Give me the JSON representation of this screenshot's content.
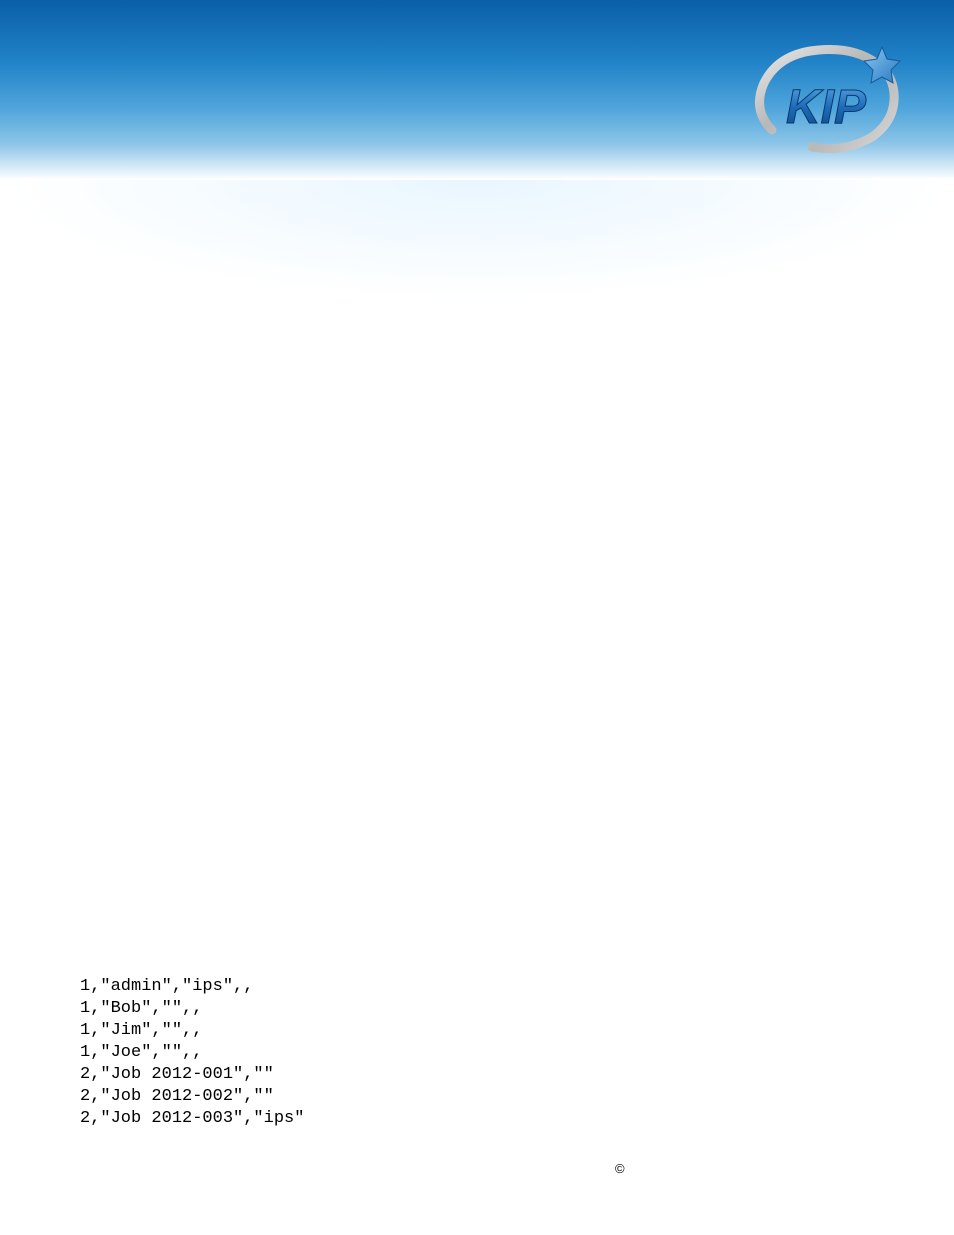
{
  "brand": {
    "name": "KIP"
  },
  "data_lines": {
    "line1": "1,\"admin\",\"ips\",,",
    "line2": "1,\"Bob\",\"\",,",
    "line3": "1,\"Jim\",\"\",,",
    "line4": "1,\"Joe\",\"\",,",
    "line5": "2,\"Job 2012-001\",\"\"",
    "line6": "2,\"Job 2012-002\",\"\"",
    "line7": "2,\"Job 2012-003\",\"ips\""
  },
  "footer": {
    "copyright_symbol": "©"
  }
}
